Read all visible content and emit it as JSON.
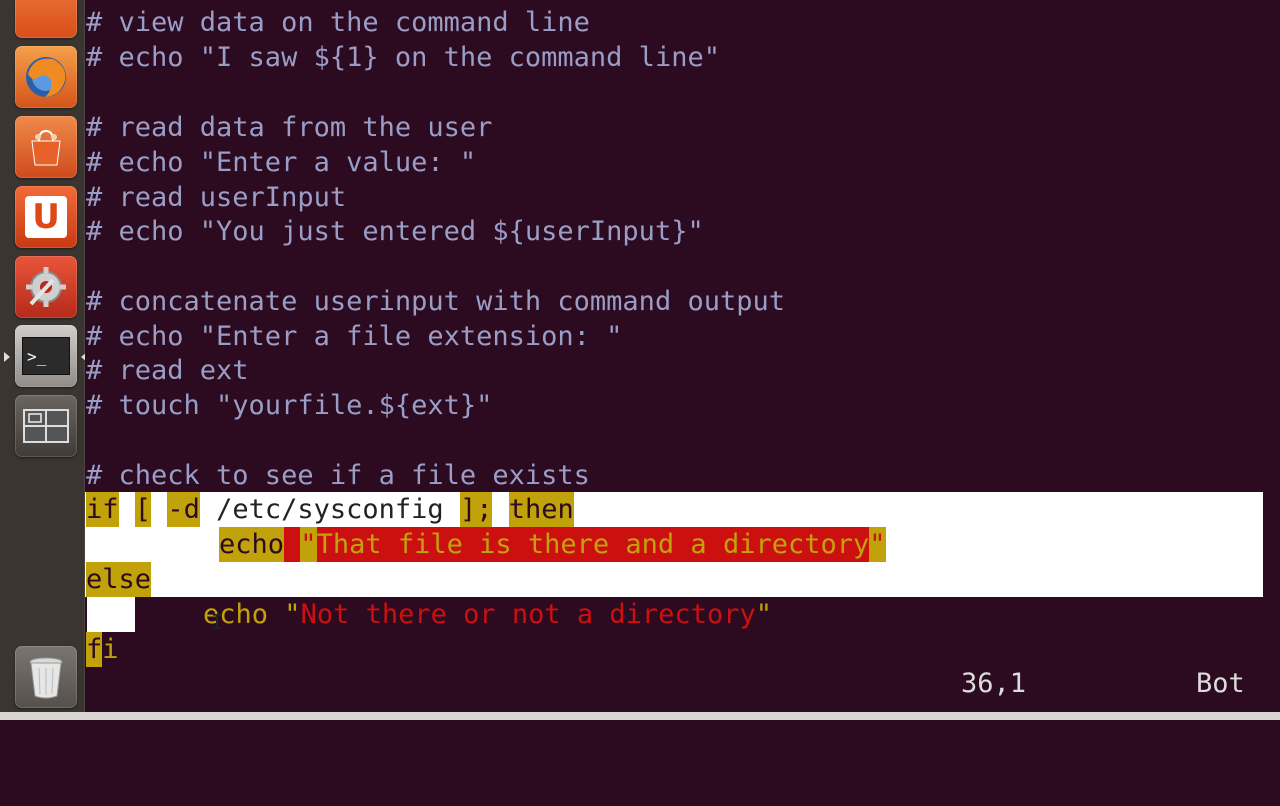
{
  "launcher": {
    "items": [
      {
        "name": "partial-app-icon",
        "color": "#e95d26"
      },
      {
        "name": "firefox-icon",
        "color": "#e66a1c"
      },
      {
        "name": "software-center-icon",
        "color": "#d9531e"
      },
      {
        "name": "ubuntu-one-icon",
        "color": "#dd4814",
        "glyph": "U"
      },
      {
        "name": "system-settings-icon",
        "color": "#c9371f"
      },
      {
        "name": "terminal-icon",
        "color": "#2e2e2e",
        "glyph": ">_"
      },
      {
        "name": "workspace-switcher-icon",
        "color": "#4a4540"
      },
      {
        "name": "trash-icon",
        "color": "#6b6662"
      }
    ]
  },
  "editor": {
    "lines": [
      "# view data on the command line",
      "# echo \"I saw ${1} on the command line\"",
      "",
      "# read data from the user",
      "# echo \"Enter a value: \"",
      "# read userInput",
      "# echo \"You just entered ${userInput}\"",
      "",
      "# concatenate userinput with command output",
      "# echo \"Enter a file extension: \"",
      "# read ext",
      "# touch \"yourfile.${ext}\"",
      "",
      "# check to see if a file exists"
    ],
    "code": {
      "if": "if",
      "bracket_open": "[",
      "flag": "-d",
      "path": "/etc/sysconfig",
      "bracket_close": "];",
      "then": "then",
      "echo1": "echo",
      "q": "\"",
      "msg1": "That file is there and a directory",
      "else": "else",
      "echo2": "echo",
      "msg2": "Not there or not a directory",
      "fi_f": "f",
      "fi_i": "i"
    },
    "status": {
      "cursor": "36,1",
      "position": "Bot"
    }
  },
  "colors": {
    "background": "#2c0a20",
    "comment": "#9a9ec7",
    "keyword": "#c2a20a",
    "string": "#cc1010",
    "selection": "#ffffff"
  }
}
